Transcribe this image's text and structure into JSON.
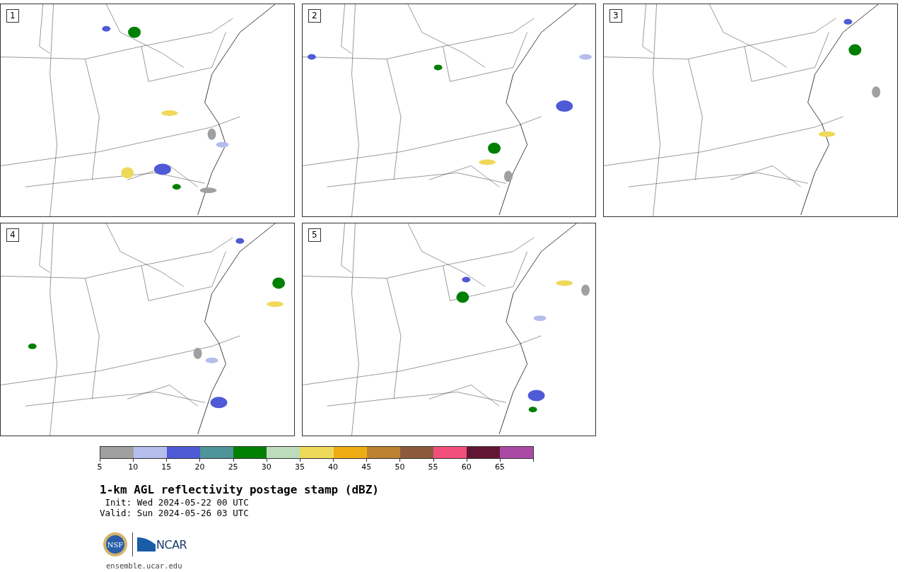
{
  "panels": [
    {
      "label": "1"
    },
    {
      "label": "2"
    },
    {
      "label": "3"
    },
    {
      "label": "4"
    },
    {
      "label": "5"
    }
  ],
  "legend": {
    "bins": [
      {
        "label": "5",
        "color": "#a0a0a0"
      },
      {
        "label": "10",
        "color": "#b4bdec"
      },
      {
        "label": "15",
        "color": "#4f5ad6"
      },
      {
        "label": "20",
        "color": "#4e9499"
      },
      {
        "label": "25",
        "color": "#008000"
      },
      {
        "label": "30",
        "color": "#bcdcbc"
      },
      {
        "label": "35",
        "color": "#efd95b"
      },
      {
        "label": "40",
        "color": "#eeac14"
      },
      {
        "label": "45",
        "color": "#bb8232"
      },
      {
        "label": "50",
        "color": "#8b5a3c"
      },
      {
        "label": "55",
        "color": "#f24e7c"
      },
      {
        "label": "60",
        "color": "#621634"
      },
      {
        "label": "65",
        "color": "#ab4aa4"
      }
    ]
  },
  "title": "1-km AGL reflectivity postage stamp (dBZ)",
  "init": " Init: Wed 2024-05-22 00 UTC",
  "valid": "Valid: Sun 2024-05-26 03 UTC",
  "logos": {
    "nsf": "NSF",
    "ncar": "NCAR"
  },
  "url": "ensemble.ucar.edu"
}
